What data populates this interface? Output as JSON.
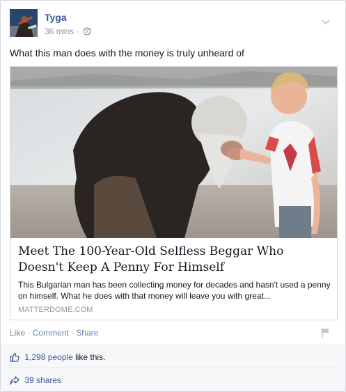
{
  "post": {
    "author": "Tyga",
    "time": "36 mins",
    "time_separator": "·",
    "status_text": "What this man does with the money is truly unheard of",
    "avatar_icon": "profile-photo",
    "privacy_icon": "globe-icon",
    "menu_icon": "chevron-down-icon"
  },
  "link": {
    "image_icon": "article-photo",
    "title": "Meet The 100-Year-Old Selfless Beggar Who Doesn't Keep A Penny For Himself",
    "description": "This Bulgarian man has been collecting money for decades and hasn't used a penny on himself. What he does with that money will leave you with great...",
    "domain": "MATTERDOME.COM"
  },
  "actions": {
    "like": "Like",
    "comment": "Comment",
    "share": "Share",
    "separator": "·",
    "flag_icon": "flag-icon"
  },
  "footer": {
    "likes_count": "1,298 people",
    "likes_suffix": " like this.",
    "shares": "39 shares",
    "like_icon": "thumbs-up-icon",
    "share_icon": "share-arrow-icon"
  },
  "colors": {
    "link_blue": "#3b5998",
    "action_blue": "#6d84b4",
    "meta_gray": "#9197a3",
    "text": "#141823",
    "footer_bg": "#f6f7f9"
  }
}
